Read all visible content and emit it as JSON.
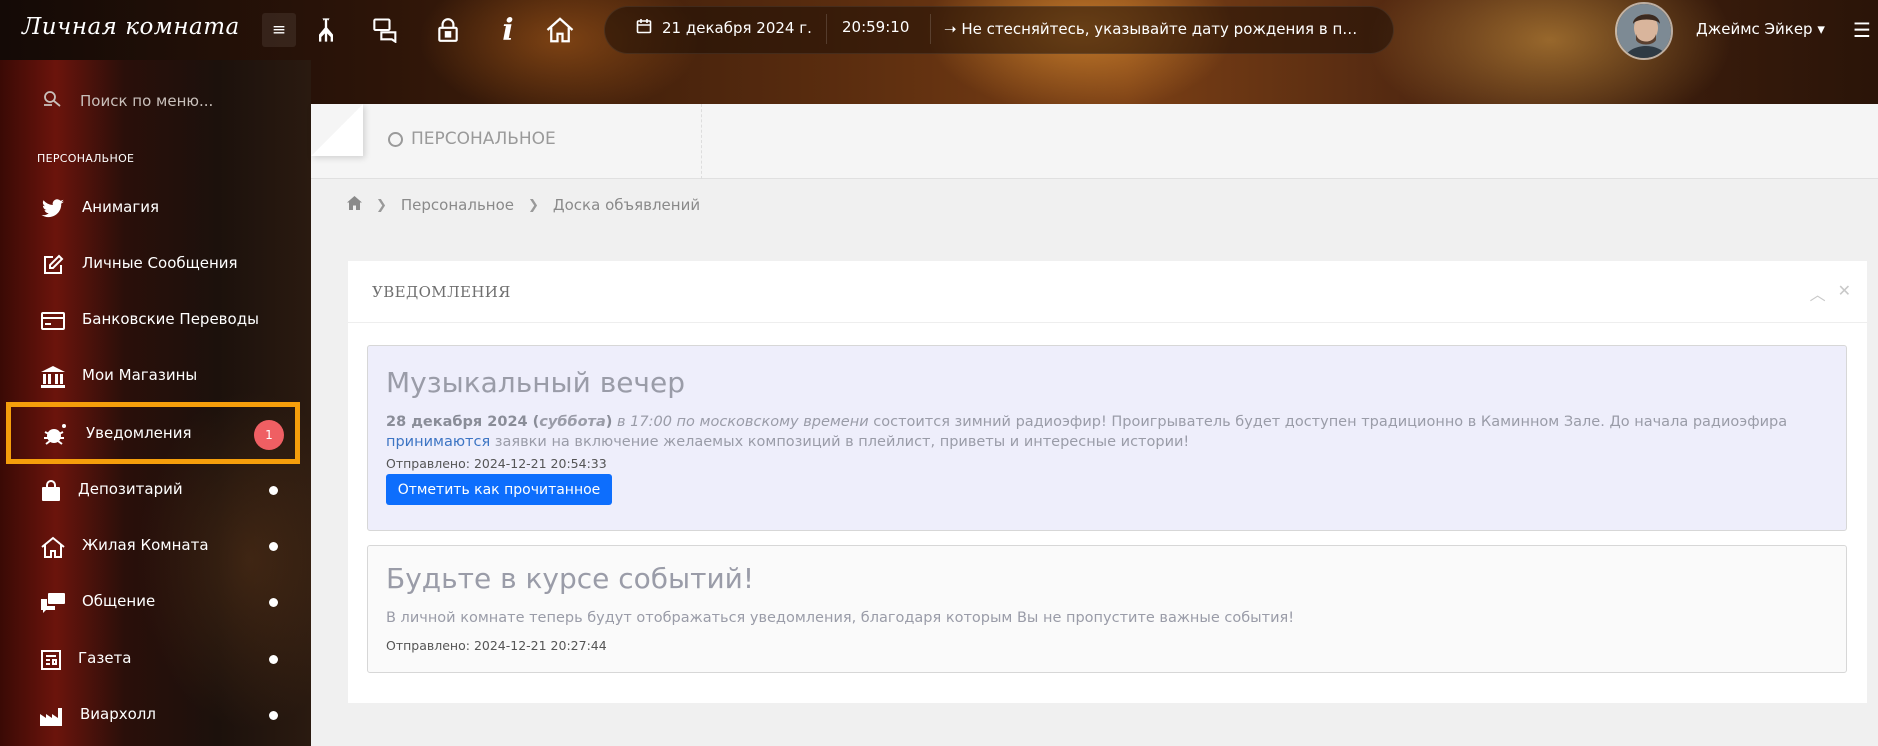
{
  "header": {
    "brand": "Личная комната",
    "date": "21 декабря 2024 г.",
    "time": "20:59:10",
    "ticker": "Не стесняйтесь, указывайте дату рождения в пр...",
    "username": "Джеймс Эйкер",
    "icons": [
      "menu-icon",
      "giraffe-icon",
      "chat-icon",
      "lock-icon",
      "info-icon",
      "home-icon",
      "calendar-icon",
      "arrow-icon",
      "caret-down-icon",
      "list-menu-icon"
    ]
  },
  "sidebar": {
    "search_placeholder": "Поиск по меню...",
    "section": "ПЕРСОНАЛЬНОЕ",
    "items": [
      {
        "label": "Анимагия",
        "icon": "twitter-bird-icon",
        "dot": false
      },
      {
        "label": "Личные Сообщения",
        "icon": "edit-icon",
        "dot": false
      },
      {
        "label": "Банковские Переводы",
        "icon": "card-icon",
        "dot": false
      },
      {
        "label": "Мои Магазины",
        "icon": "bank-icon",
        "dot": false
      },
      {
        "label": "Уведомления",
        "icon": "bug-icon",
        "badge": "1"
      },
      {
        "label": "Депозитарий",
        "icon": "bag-icon",
        "dot": true
      },
      {
        "label": "Жилая Комната",
        "icon": "house-icon",
        "dot": true
      },
      {
        "label": "Общение",
        "icon": "comments-icon",
        "dot": true
      },
      {
        "label": "Газета",
        "icon": "newspaper-icon",
        "dot": true
      },
      {
        "label": "Виархолл",
        "icon": "factory-icon",
        "dot": true
      }
    ]
  },
  "main": {
    "page_title": "ПЕРСОНАЛЬНОЕ",
    "breadcrumb": [
      "Персональное",
      "Доска объявлений"
    ],
    "panel_title": "УВЕДОМЛЕНИЯ",
    "notifications": [
      {
        "title": "Музыкальный вечер",
        "body_bold": "28 декабря 2024 (",
        "body_bold_italic": "суббота",
        "body_bold_end": ")",
        "body_italic": "в 17:00 по московскому времени",
        "body_text": "состоится зимний радиоэфир! Проигрыватель будет доступен традиционно в Каминном Зале. До начала радиоэфира",
        "body_link": "принимаются",
        "body_text2": "заявки на включение желаемых композиций в плейлист, приветы и интересные истории!",
        "sent": "Отправлено: 2024-12-21 20:54:33",
        "button": "Отметить как прочитанное"
      },
      {
        "title": "Будьте в курсе событий!",
        "body_text": "В личной комнате теперь будут отображаться уведомления, благодаря которым Вы не пропустите важные события!",
        "sent": "Отправлено: 2024-12-21 20:27:44"
      }
    ]
  },
  "colors": {
    "accent_button": "#0d6efd",
    "highlight": "#f59e0b",
    "badge": "#ef5f63",
    "unread_bg": "#eeeefb"
  }
}
